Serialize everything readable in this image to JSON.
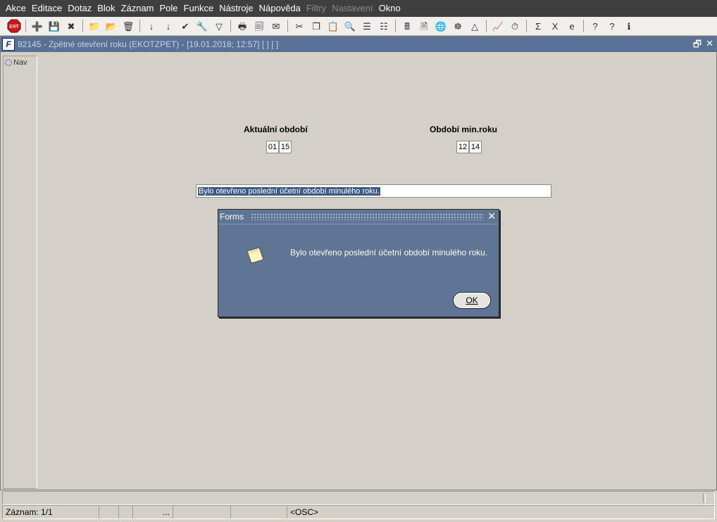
{
  "menubar": {
    "items": [
      {
        "label": "Akce",
        "disabled": false
      },
      {
        "label": "Editace",
        "disabled": false
      },
      {
        "label": "Dotaz",
        "disabled": false
      },
      {
        "label": "Blok",
        "disabled": false
      },
      {
        "label": "Záznam",
        "disabled": false
      },
      {
        "label": "Pole",
        "disabled": false
      },
      {
        "label": "Funkce",
        "disabled": false
      },
      {
        "label": "Nástroje",
        "disabled": false
      },
      {
        "label": "Nápověda",
        "disabled": false
      },
      {
        "label": "Filtry",
        "disabled": true
      },
      {
        "label": "Nastavení",
        "disabled": true
      },
      {
        "label": "Okno",
        "disabled": false
      }
    ]
  },
  "toolbar": {
    "icons": [
      "exit-icon",
      "insert-record-icon",
      "save-icon",
      "delete-record-icon",
      "query-icon",
      "execute-query-icon",
      "cancel-query-icon",
      "sort-asc-icon",
      "sort-desc-icon",
      "check-icon",
      "wrench-icon",
      "filter-icon",
      "print-icon",
      "print-preview-icon",
      "mail-icon",
      "cut-icon",
      "copy-icon",
      "paste-icon",
      "find-icon",
      "list-icon",
      "split-icon",
      "calculator-icon",
      "document-icon",
      "globe-icon",
      "wheel-icon",
      "triangle-icon",
      "chart-icon",
      "clock-icon",
      "sum-icon",
      "excel-icon",
      "ie-icon",
      "help-book-icon",
      "help-icon",
      "info-icon"
    ],
    "glyphs": [
      "⛔",
      "➕",
      "💾",
      "✖",
      "📁",
      "📂",
      "🗑",
      "↓",
      "↓",
      "✔",
      "🔧",
      "▽",
      "🖶",
      "🗐",
      "✉",
      "✂",
      "❐",
      "📋",
      "🔍",
      "☰",
      "☷",
      "🖩",
      "🗎",
      "🌐",
      "☸",
      "△",
      "📈",
      "⏱",
      "Σ",
      "X",
      "e",
      "?",
      "?",
      "ℹ"
    ],
    "exit_label": "EXIT"
  },
  "window": {
    "app_icon": "F",
    "title": "92145 - Zpětné otevření roku (EKOTZPET) - [19.01.2018; 12:57]  [ ]  [ ]",
    "restore_glyph": "🗗",
    "close_glyph": "✕"
  },
  "nav": {
    "label": "Nav"
  },
  "form": {
    "aktualni_label": "Aktuální období",
    "aktualni_month": "01",
    "aktualni_year": "15",
    "min_label": "Období min.roku",
    "min_month": "12",
    "min_year": "14",
    "message": "Bylo otevřeno poslední účetní období minulého roku."
  },
  "dialog": {
    "title": "Forms",
    "close_glyph": "✕",
    "message": "Bylo otevřeno poslední účetní období minulého roku.",
    "ok_label": "OK"
  },
  "statusbar": {
    "record": "Záznam: 1/1",
    "cell2": "",
    "cell3": "",
    "cell4": "...",
    "cell5": "",
    "cell6": "",
    "osc": "<OSC>"
  }
}
